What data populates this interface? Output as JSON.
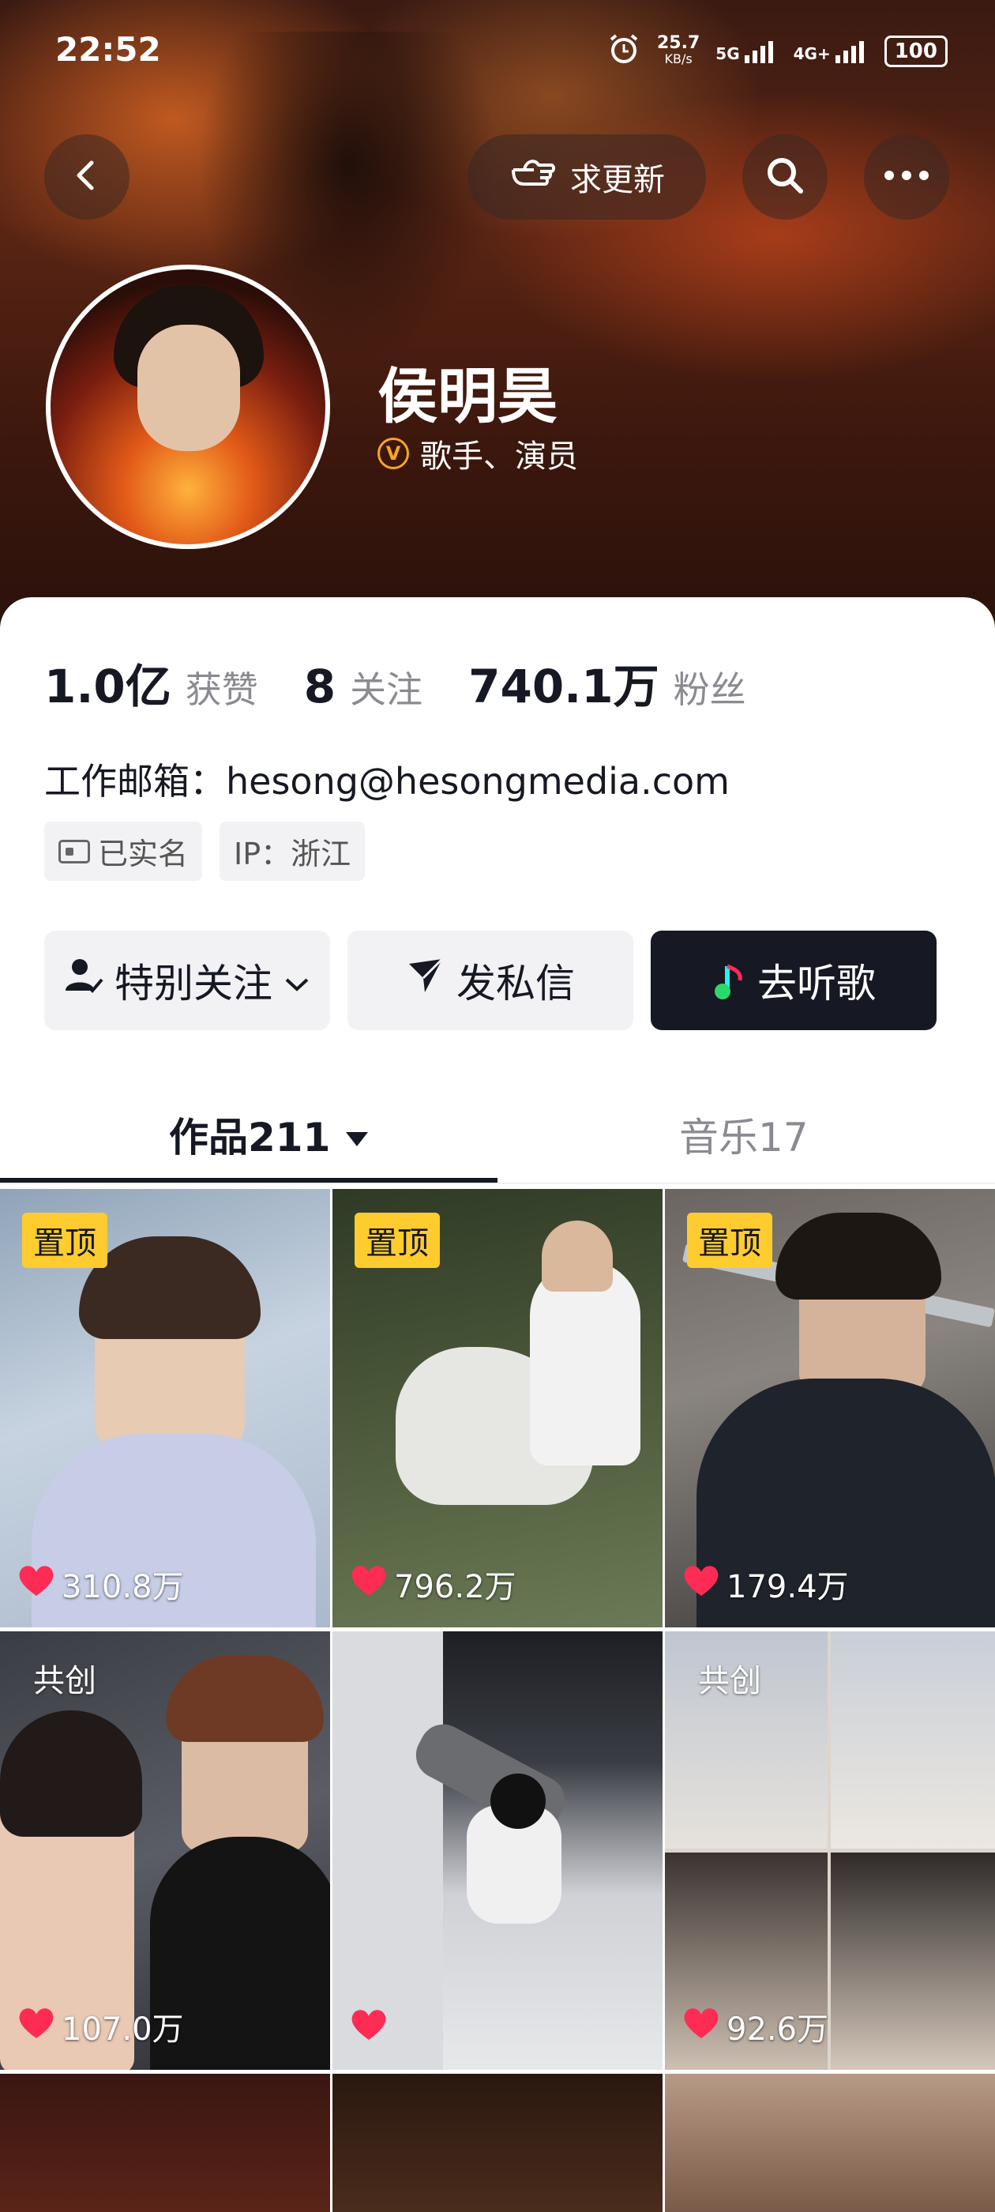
{
  "status_bar": {
    "time": "22:52",
    "net_speed": "25.7",
    "net_unit": "KB/s",
    "signal_1": "5G",
    "signal_2": "4G+",
    "battery": "100"
  },
  "header": {
    "update_label": "求更新",
    "icons": [
      "back-icon",
      "hand-pointer-icon",
      "search-icon",
      "more-icon"
    ]
  },
  "profile": {
    "name": "侯明昊",
    "verify_badge": "V",
    "title": "歌手、演员"
  },
  "stats": {
    "likes_num": "1.0亿",
    "likes_label": "获赞",
    "following_num": "8",
    "following_label": "关注",
    "followers_num": "740.1万",
    "followers_label": "粉丝"
  },
  "bio": {
    "email": "工作邮箱：hesong@hesongmedia.com"
  },
  "tags": {
    "verified": "已实名",
    "ip": "IP：浙江"
  },
  "actions": {
    "follow": "特别关注",
    "message": "发私信",
    "listen": "去听歌"
  },
  "tabs": {
    "works": "作品211",
    "music": "音乐17"
  },
  "grid": {
    "items": [
      {
        "badge": "置顶",
        "likes": "310.8万"
      },
      {
        "badge": "置顶",
        "likes": "796.2万"
      },
      {
        "badge": "置顶",
        "likes": "179.4万"
      },
      {
        "badge": "共创",
        "likes": "107.0万"
      },
      {
        "badge": "",
        "likes": ""
      },
      {
        "badge": "共创",
        "likes": "92.6万"
      }
    ]
  },
  "colors": {
    "pin_yellow": "#fecc2f",
    "like_red": "#fe2c55",
    "dark": "#161823",
    "verify_orange": "#f5a623"
  }
}
